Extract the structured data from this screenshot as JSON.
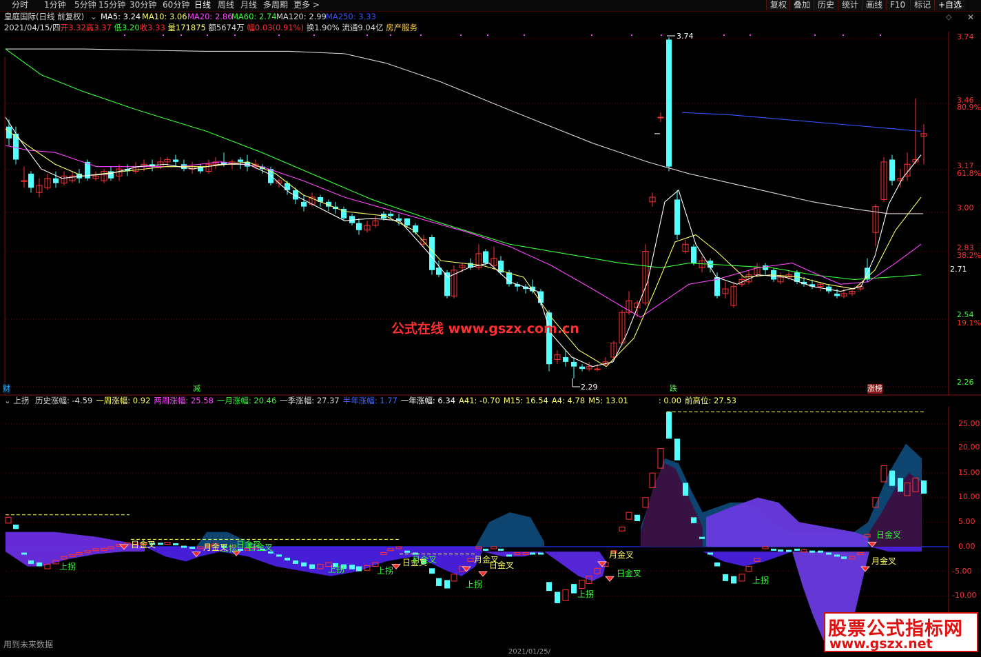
{
  "toolbar": {
    "periods": [
      "分时",
      "1分钟",
      "5分钟",
      "15分钟",
      "30分钟",
      "60分钟",
      "日线",
      "周线",
      "月线",
      "多周期",
      "更多 >"
    ],
    "active_period": "日线",
    "right_buttons": [
      "复权",
      "叠加",
      "历史",
      "统计",
      "画线",
      "F10",
      "标记",
      "+自选"
    ],
    "icons": [
      "diamond-icon",
      "close-icon"
    ]
  },
  "info": {
    "stock_name": "皇庭国际(日线 前复权)",
    "ma5": "MA5: 3.24",
    "ma10": "MA10: 3.06",
    "ma20": "MA20: 2.86",
    "ma60": "MA60: 2.74",
    "ma120": "MA120: 2.99",
    "ma250": "MA250: 3.33",
    "date": "2021/04/15/四",
    "open_label": "开",
    "open": "3.32",
    "high_label": "高",
    "high": "3.37",
    "low_label": "低",
    "low": "3.20",
    "close_label": "收",
    "close": "3.33",
    "vol_label": "量",
    "vol": "171875",
    "amt_label": "额",
    "amt": "5674万",
    "chg_label": "幅",
    "chg": "0.03(0.91%)",
    "turn_label": "换",
    "turn": "1.90%",
    "float_label": "流通",
    "float": "9.04亿",
    "industry": "房产服务"
  },
  "price_axis": {
    "labels": [
      "3.74",
      "3.46",
      "80.9%",
      "3.17",
      "61.8%",
      "3.00",
      "2.83",
      "38.2%",
      "2.71",
      "2.54",
      "19.1%",
      "2.26"
    ],
    "current": "2.71"
  },
  "annotations": {
    "high": "3.74",
    "low": "2.29",
    "markers": [
      "财",
      "减",
      "跌",
      "涨榜"
    ]
  },
  "indicator": {
    "name": "上拐",
    "items": [
      {
        "label": "历史涨幅:",
        "value": "-4.59",
        "color": "#d8d8d8"
      },
      {
        "label": "一周涨幅:",
        "value": "0.92",
        "color": "#ffff66"
      },
      {
        "label": "两周涨幅:",
        "value": "25.58",
        "color": "#ff44ff"
      },
      {
        "label": "一月涨幅:",
        "value": "20.46",
        "color": "#33ff33"
      },
      {
        "label": "一季涨幅:",
        "value": "27.37",
        "color": "#d8d8d8"
      },
      {
        "label": "半年涨幅:",
        "value": "1.77",
        "color": "#4466ff"
      },
      {
        "label": "一年涨幅:",
        "value": "6.34",
        "color": "#ffffff"
      },
      {
        "label": "A41:",
        "value": "-0.70",
        "color": "#ffff66"
      },
      {
        "label": "M15:",
        "value": "16.54",
        "color": "#ffff66"
      },
      {
        "label": "A4:",
        "value": "4.78",
        "color": "#ffff66"
      },
      {
        "label": "M5:",
        "value": "13.01",
        "color": "#ffff66"
      },
      {
        "label": ":",
        "value": "0.00",
        "color": "#ffff66"
      },
      {
        "label": "前高位:",
        "value": "27.53",
        "color": "#ffff66"
      }
    ],
    "axis": [
      "25.00",
      "20.00",
      "15.00",
      "10.00",
      "5.00",
      "0.00",
      "-5.00",
      "-10.00"
    ],
    "signals": [
      "上拐",
      "日金叉",
      "月金叉",
      "日金叉",
      "上拐",
      "日金叉",
      "上拐",
      "月金叉",
      "上拐",
      "日金叉",
      "月金叉",
      "日金叉",
      "上拐",
      "日金叉",
      "月金叉",
      "上拐",
      "上拐",
      "日金叉",
      "月金叉"
    ]
  },
  "footer": {
    "note": "用到未来数据",
    "date": "2021/01/25/"
  },
  "watermarks": {
    "gszx": "公式在线  www.gszx.com.cn",
    "brand_top": "股票公式指标网",
    "brand_bottom": "www.gszx.net"
  },
  "colors": {
    "up": "#ff3232",
    "down": "#54ffff",
    "ma5": "#ffffff",
    "ma10": "#ffff66",
    "ma20": "#ff44ff",
    "ma60": "#33ff33",
    "ma120": "#d8d8d8",
    "ma250": "#3355ff"
  }
}
